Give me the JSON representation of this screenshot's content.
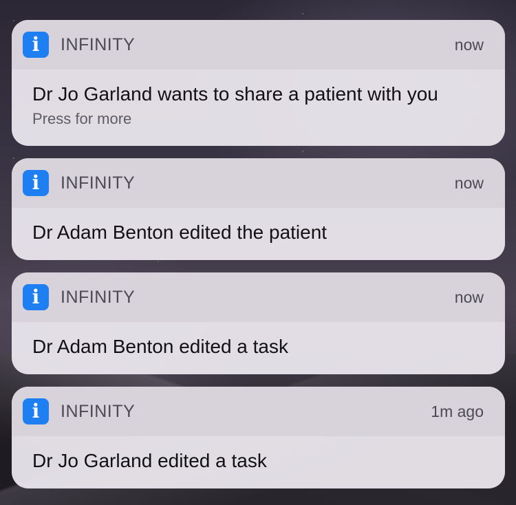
{
  "notifications": [
    {
      "app_name": "INFINITY",
      "app_icon": "info-icon",
      "time": "now",
      "message": "Dr Jo Garland wants to share a patient with you",
      "sub": "Press for more"
    },
    {
      "app_name": "INFINITY",
      "app_icon": "info-icon",
      "time": "now",
      "message": "Dr Adam Benton edited the patient"
    },
    {
      "app_name": "INFINITY",
      "app_icon": "info-icon",
      "time": "now",
      "message": "Dr Adam Benton edited a task"
    },
    {
      "app_name": "INFINITY",
      "app_icon": "info-icon",
      "time": "1m ago",
      "message": "Dr Jo Garland edited a task"
    }
  ],
  "icon_glyph": "i",
  "colors": {
    "app_icon_bg": "#1d7ff2",
    "card_bg": "#ece8ee",
    "header_bg": "#d7d2da"
  }
}
